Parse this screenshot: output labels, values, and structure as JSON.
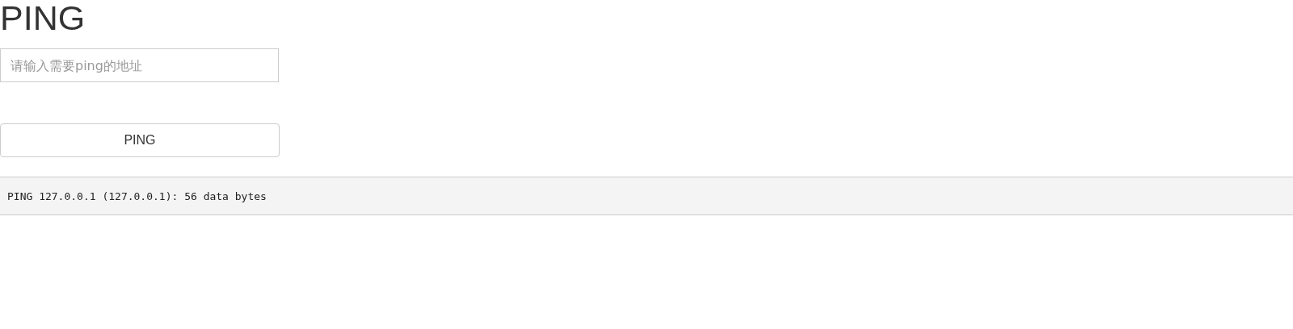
{
  "title": "PING",
  "address_field": {
    "placeholder": "请输入需要ping的地址"
  },
  "ping_button": "PING",
  "output": "PING 127.0.0.1 (127.0.0.1): 56 data bytes"
}
